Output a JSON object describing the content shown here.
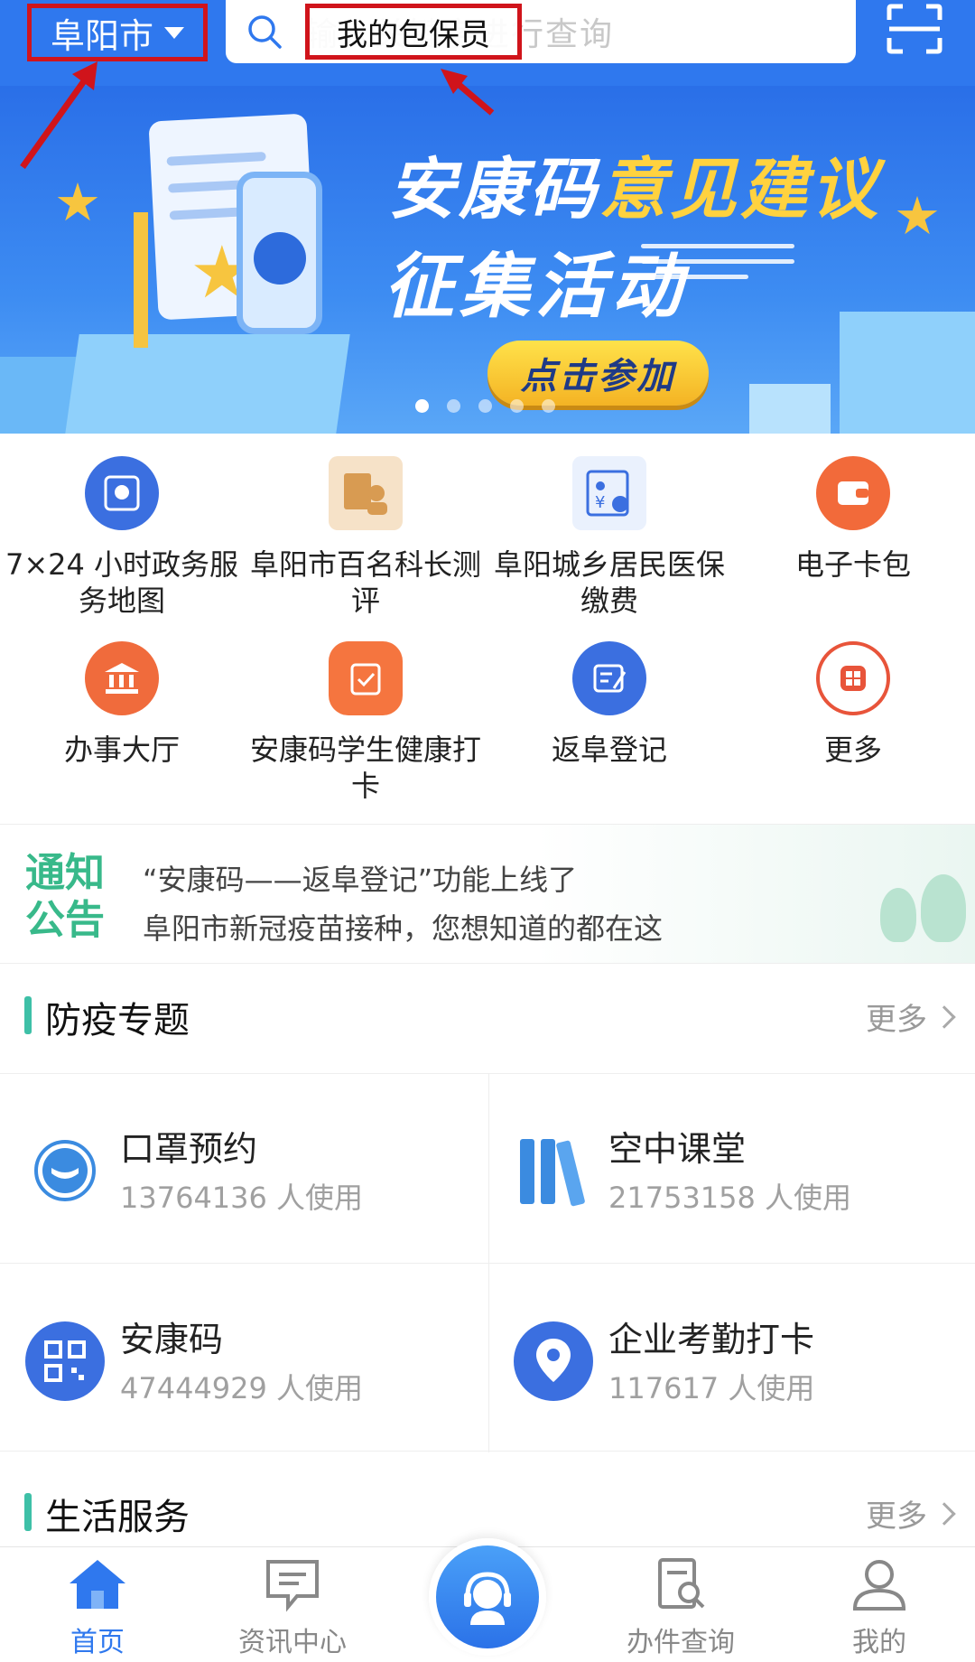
{
  "header": {
    "city": "阜阳市",
    "search_placeholder": "输入关键字进行查询",
    "search_hint": "我的包保员"
  },
  "banner": {
    "title_white": "安康码",
    "title_yellow": "意见建议",
    "subtitle": "征集活动",
    "cta": "点击参加"
  },
  "services": [
    {
      "label": "7×24 小时政务服务地图",
      "icon": "map-icon"
    },
    {
      "label": "阜阳市百名科长测评",
      "icon": "evaluation-icon"
    },
    {
      "label": "阜阳城乡居民医保缴费",
      "icon": "medical-insurance-icon"
    },
    {
      "label": "电子卡包",
      "icon": "wallet-icon"
    },
    {
      "label": "办事大厅",
      "icon": "hall-icon"
    },
    {
      "label": "安康码学生健康打卡",
      "icon": "health-checkin-icon"
    },
    {
      "label": "返阜登记",
      "icon": "registration-icon"
    },
    {
      "label": "更多",
      "icon": "more-icon"
    }
  ],
  "notice": {
    "tag_line1": "通知",
    "tag_line2": "公告",
    "items": [
      "“安康码——返阜登记”功能上线了",
      "阜阳市新冠疫苗接种，您想知道的都在这"
    ]
  },
  "section_epidemic": {
    "title": "防疫专题",
    "more": "更多"
  },
  "epidemic_cards": [
    {
      "name": "口罩预约",
      "usage": "13764136 人使用",
      "icon": "mask-icon"
    },
    {
      "name": "空中课堂",
      "usage": "21753158 人使用",
      "icon": "books-icon"
    },
    {
      "name": "安康码",
      "usage": "47444929 人使用",
      "icon": "qr-code-icon"
    },
    {
      "name": "企业考勤打卡",
      "usage": "117617 人使用",
      "icon": "location-pin-icon"
    }
  ],
  "section_life": {
    "title": "生活服务",
    "more": "更多"
  },
  "tabbar": [
    {
      "label": "首页",
      "icon": "home-icon",
      "active": true
    },
    {
      "label": "资讯中心",
      "icon": "message-icon",
      "active": false
    },
    {
      "label": "办件查询",
      "icon": "document-search-icon",
      "active": false
    },
    {
      "label": "我的",
      "icon": "user-icon",
      "active": false
    }
  ],
  "colors": {
    "primary": "#2f78ee",
    "accent_green": "#3ec0a7",
    "highlight_red": "#d0141b",
    "banner_yellow": "#ffd23f"
  }
}
